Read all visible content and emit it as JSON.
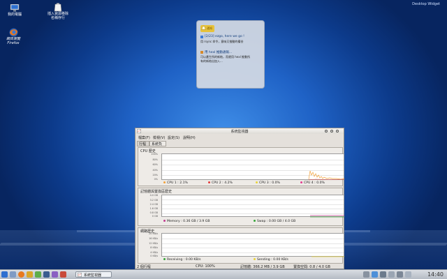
{
  "desktop": {
    "name": "Desktop Widget",
    "icons": [
      {
        "label": "我的電腦",
        "icon": "computer-icon"
      },
      {
        "label": "插入資源移除\n名稱存行",
        "icon": "removable-drive-icon"
      },
      {
        "label": "網頁瀏覽\nFirefox",
        "icon": "firefox-icon"
      }
    ]
  },
  "notifications": {
    "header": "通知",
    "items": [
      {
        "title": "[2/23] ezgo, here we go !",
        "body": "用 rsync 命令，意味又推動的備份"
      },
      {
        "title": "用 hexl 推動通報...",
        "body": "可以產生所的新結，而就用 hexl 推動所",
        "body2": "有的新結出加入..."
      }
    ]
  },
  "window": {
    "title": "系統監視器",
    "menu": [
      "檔案(F)",
      "檢視(V)",
      "設定(S)",
      "說明(H)"
    ],
    "tabs": [
      "行程表",
      "系統負載"
    ],
    "cpu": {
      "title": "CPU 歷史",
      "yticks": [
        "100%",
        "80%",
        "60%",
        "40%",
        "20%",
        "0%"
      ],
      "legend": [
        {
          "label": "CPU 1 : 2.1%",
          "color": "#f2a23a"
        },
        {
          "label": "CPU 2 : 4.2%",
          "color": "#e33b3b"
        },
        {
          "label": "CPU 3 : 0.0%",
          "color": "#e8d33a"
        },
        {
          "label": "CPU 4 : 0.0%",
          "color": "#e33b8f"
        }
      ]
    },
    "memory": {
      "title": "記憶體與置換區歷史",
      "yticks": [
        "4.0 GB",
        "3.2 GB",
        "2.4 GB",
        "1.6 GB",
        "0.8 GB",
        "0 GB"
      ],
      "legend": [
        {
          "label": "Memory : 0.36 GB / 3.9 GB",
          "color": "#c23b8f"
        },
        {
          "label": "Swap : 0.00 GB / 4.0 GB",
          "color": "#37a63b"
        }
      ]
    },
    "network": {
      "title": "網路歷史",
      "yticks": [
        "20 KB/s",
        "16 KB/s",
        "12 KB/s",
        "8 KB/s",
        "4 KB/s",
        "0 KB/s"
      ],
      "legend": [
        {
          "label": "Receiving : 0.00 KB/s",
          "color": "#37a63b"
        },
        {
          "label": "Sending : 0.00 KB/s",
          "color": "#e8d33a"
        }
      ]
    },
    "status": {
      "processes": "2 個行程",
      "cpu": "CPU: 100%",
      "memory": "記憶體: 366.2 MB / 3.9 GB",
      "swap": "置換空間: 0.8 / 4.0 GB"
    }
  },
  "taskbar": {
    "task_label": "系統監視器",
    "clock": "14:40"
  }
}
